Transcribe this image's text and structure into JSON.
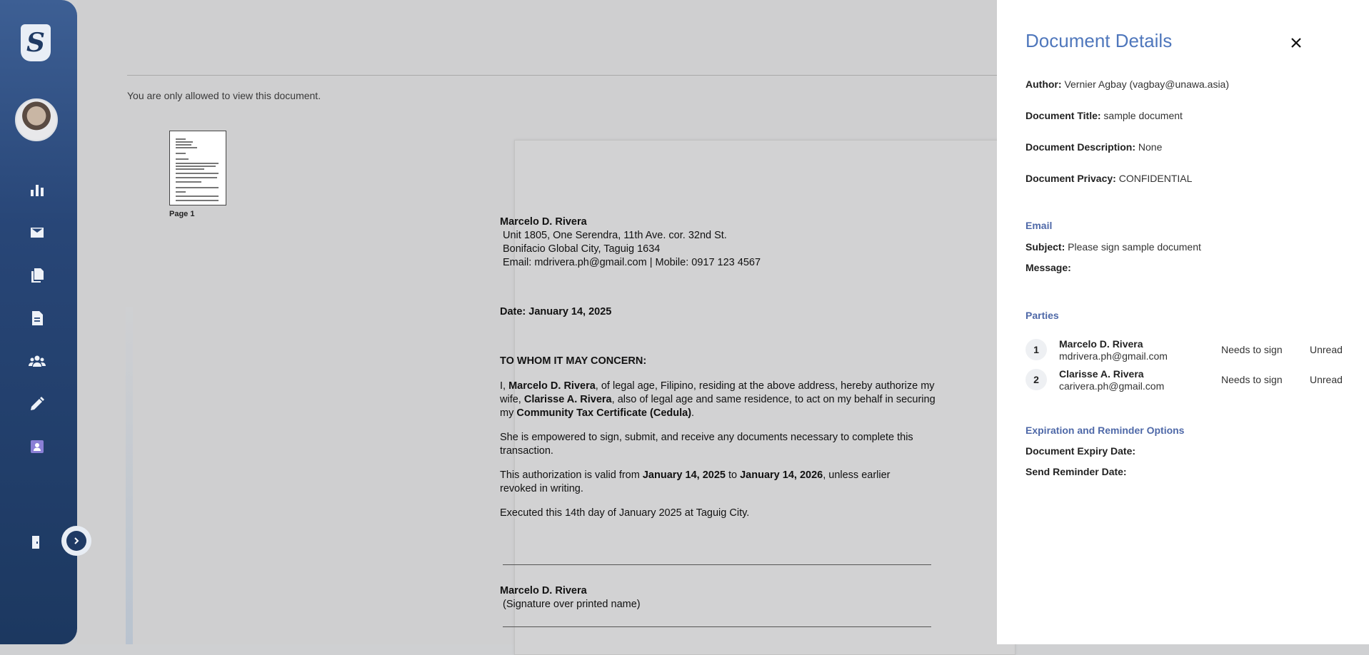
{
  "sidebar": {
    "logo_letter": "S",
    "icons": [
      "dashboard-chart-icon",
      "mail-icon",
      "documents-icon",
      "file-icon",
      "team-icon",
      "pencil-icon",
      "contact-book-icon",
      "logout-icon"
    ]
  },
  "viewer": {
    "view_note": "You are only allowed to view this document.",
    "page_label": "Page 1"
  },
  "document": {
    "sender_name": "Marcelo D. Rivera",
    "address1": "Unit 1805, One Serendra, 11th Ave. cor. 32nd St.",
    "address2": "Bonifacio Global City, Taguig 1634",
    "contact": "Email: mdrivera.ph@gmail.com | Mobile: 0917 123 4567",
    "date": "Date: January 14, 2025",
    "salutation": "TO WHOM IT MAY CONCERN:",
    "p1_a": "I, ",
    "p1_name": "Marcelo D. Rivera",
    "p1_b": ", of legal age, Filipino, residing at the above address, hereby authorize my",
    "p1_c": "wife, ",
    "p1_wife": "Clarisse A. Rivera",
    "p1_d": ", also of legal age and same residence, to act on my behalf in securing",
    "p1_e": "my ",
    "p1_cert": "Community Tax Certificate (Cedula)",
    "p1_f": ".",
    "p2": "She is empowered to sign, submit, and receive any documents necessary to complete this transaction.",
    "p3_a": "This authorization is valid from ",
    "p3_from": "January 14, 2025",
    "p3_b": " to ",
    "p3_to": "January 14, 2026",
    "p3_c": ", unless earlier revoked in writing.",
    "p4": "Executed this 14th day of January 2025 at Taguig City.",
    "signer_name": "Marcelo D. Rivera",
    "signer_caption": "(Signature over printed name)"
  },
  "details": {
    "title": "Document Details",
    "author_label": "Author:",
    "author_value": "Vernier Agbay (vagbay@unawa.asia)",
    "doc_title_label": "Document Title:",
    "doc_title_value": "sample document",
    "doc_desc_label": "Document Description:",
    "doc_desc_value": "None",
    "doc_privacy_label": "Document Privacy:",
    "doc_privacy_value": "CONFIDENTIAL",
    "email_heading": "Email",
    "subject_label": "Subject:",
    "subject_value": "Please sign sample document",
    "message_label": "Message:",
    "parties_heading": "Parties",
    "parties": [
      {
        "num": "1",
        "name": "Marcelo D. Rivera",
        "email": "mdrivera.ph@gmail.com",
        "status": "Needs to sign",
        "read": "Unread"
      },
      {
        "num": "2",
        "name": "Clarisse A. Rivera",
        "email": "carivera.ph@gmail.com",
        "status": "Needs to sign",
        "read": "Unread"
      }
    ],
    "expiration_heading": "Expiration and Reminder Options",
    "expiry_label": "Document Expiry Date:",
    "reminder_label": "Send Reminder Date:"
  }
}
